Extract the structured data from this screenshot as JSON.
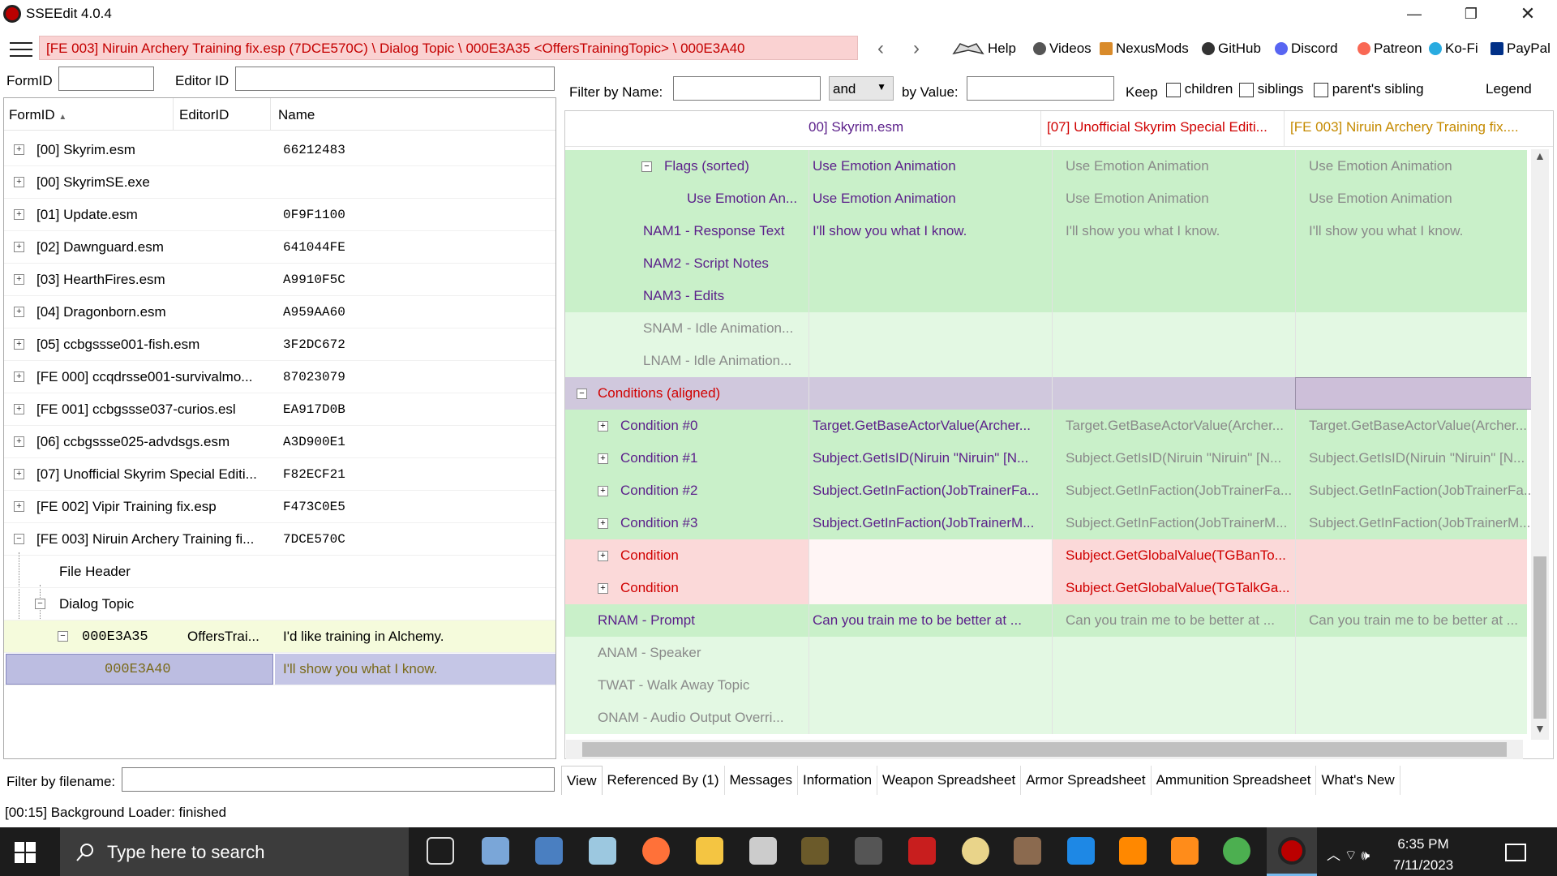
{
  "window": {
    "title": "SSEEdit 4.0.4",
    "minimize_glyph": "—",
    "maximize_glyph": "❐",
    "close_glyph": "✕"
  },
  "nav": {
    "path": "[FE 003] Niruin Archery Training fix.esp (7DCE570C) \\ Dialog Topic \\ 000E3A35 <OffersTrainingTopic> \\ 000E3A40",
    "back_glyph": "‹",
    "forward_glyph": "›",
    "links": [
      "Help",
      "Videos",
      "NexusMods",
      "GitHub",
      "Discord",
      "Patreon",
      "Ko-Fi",
      "PayPal"
    ]
  },
  "left": {
    "formid_label": "FormID",
    "editorid_label": "Editor ID",
    "formid_value": "",
    "editorid_value": "",
    "columns": [
      "FormID",
      "EditorID",
      "Name"
    ],
    "rows": [
      {
        "name": "[00] Skyrim.esm",
        "id": "66212483"
      },
      {
        "name": "[00] SkyrimSE.exe",
        "id": ""
      },
      {
        "name": "[01] Update.esm",
        "id": "0F9F1100"
      },
      {
        "name": "[02] Dawnguard.esm",
        "id": "641044FE"
      },
      {
        "name": "[03] HearthFires.esm",
        "id": "A9910F5C"
      },
      {
        "name": "[04] Dragonborn.esm",
        "id": "A959AA60"
      },
      {
        "name": "[05] ccbgssse001-fish.esm",
        "id": "3F2DC672"
      },
      {
        "name": "[FE 000] ccqdrsse001-survivalmo...",
        "id": "87023079"
      },
      {
        "name": "[FE 001] ccbgssse037-curios.esl",
        "id": "EA917D0B"
      },
      {
        "name": "[06] ccbgssse025-advdsgs.esm",
        "id": "A3D900E1"
      },
      {
        "name": "[07] Unofficial Skyrim Special Editi...",
        "id": "F82ECF21"
      },
      {
        "name": "[FE 002] Vipir Training fix.esp",
        "id": "F473C0E5"
      },
      {
        "name": "[FE 003] Niruin Archery Training fi...",
        "id": "7DCE570C"
      }
    ],
    "file_header": "File Header",
    "dialog_topic": "Dialog Topic",
    "topic": {
      "formid": "000E3A35",
      "editorid": "OffersTrai...",
      "name": "I'd like training in Alchemy."
    },
    "selected": {
      "formid": "000E3A40",
      "name": "I'll show you what I know."
    },
    "filter_label": "Filter by filename:",
    "filter_value": ""
  },
  "right": {
    "filter_name_label": "Filter by Name:",
    "and_label": "and",
    "by_value_label": "by Value:",
    "keep_label": "Keep",
    "children_label": "children",
    "siblings_label": "siblings",
    "parents_sibling_label": "parent's sibling",
    "legend_label": "Legend",
    "col_heads": [
      "00] Skyrim.esm",
      "[07] Unofficial Skyrim Special Editi...",
      "[FE 003] Niruin Archery Training fix...."
    ],
    "rows": [
      {
        "label": "Flags (sorted)",
        "v1": "Use Emotion Animation",
        "v2": "Use Emotion Animation",
        "v3": "Use Emotion Animation"
      },
      {
        "label": "Use Emotion An...",
        "v1": "Use Emotion Animation",
        "v2": "Use Emotion Animation",
        "v3": "Use Emotion Animation"
      },
      {
        "label": "NAM1 - Response Text",
        "v1": "I'll show you what I know.",
        "v2": "I'll show you what I know.",
        "v3": "I'll show you what I know."
      },
      {
        "label": "NAM2 - Script Notes",
        "v1": "",
        "v2": "",
        "v3": ""
      },
      {
        "label": "NAM3 - Edits",
        "v1": "",
        "v2": "",
        "v3": ""
      },
      {
        "label": "SNAM - Idle Animation...",
        "v1": "",
        "v2": "",
        "v3": ""
      },
      {
        "label": "LNAM - Idle Animation...",
        "v1": "",
        "v2": "",
        "v3": ""
      },
      {
        "label": "Conditions (aligned)",
        "v1": "",
        "v2": "",
        "v3": ""
      },
      {
        "label": "Condition #0",
        "v1": "Target.GetBaseActorValue(Archer...",
        "v2": "Target.GetBaseActorValue(Archer...",
        "v3": "Target.GetBaseActorValue(Archer..."
      },
      {
        "label": "Condition #1",
        "v1": "Subject.GetIsID(Niruin \"Niruin\" [N...",
        "v2": "Subject.GetIsID(Niruin \"Niruin\" [N...",
        "v3": "Subject.GetIsID(Niruin \"Niruin\" [N..."
      },
      {
        "label": "Condition #2",
        "v1": "Subject.GetInFaction(JobTrainerFa...",
        "v2": "Subject.GetInFaction(JobTrainerFa...",
        "v3": "Subject.GetInFaction(JobTrainerFa..."
      },
      {
        "label": "Condition #3",
        "v1": "Subject.GetInFaction(JobTrainerM...",
        "v2": "Subject.GetInFaction(JobTrainerM...",
        "v3": "Subject.GetInFaction(JobTrainerM..."
      },
      {
        "label": "Condition",
        "v1": "",
        "v2": "Subject.GetGlobalValue(TGBanTo...",
        "v3": ""
      },
      {
        "label": "Condition",
        "v1": "",
        "v2": "Subject.GetGlobalValue(TGTalkGa...",
        "v3": ""
      },
      {
        "label": "RNAM - Prompt",
        "v1": "Can you train me to be better at ...",
        "v2": "Can you train me to be better at ...",
        "v3": "Can you train me to be better at ..."
      },
      {
        "label": "ANAM - Speaker",
        "v1": "",
        "v2": "",
        "v3": ""
      },
      {
        "label": "TWAT - Walk Away Topic",
        "v1": "",
        "v2": "",
        "v3": ""
      },
      {
        "label": "ONAM - Audio Output Overri...",
        "v1": "",
        "v2": "",
        "v3": ""
      }
    ],
    "tabs": [
      "View",
      "Referenced By (1)",
      "Messages",
      "Information",
      "Weapon Spreadsheet",
      "Armor Spreadsheet",
      "Ammunition Spreadsheet",
      "What's New"
    ]
  },
  "status": "[00:15] Background Loader: finished",
  "taskbar": {
    "search_placeholder": "Type here to search",
    "time": "6:35 PM",
    "date": "7/11/2023",
    "tray_glyphs": "︿ ⌔ 🕪"
  },
  "colors": {
    "path_bg": "#fad2d2",
    "path_text": "#c40000",
    "green": "#c9f0c9",
    "purple": "#d0c8dd",
    "pink": "#fbd9d9",
    "selection": "#bcbde1"
  }
}
